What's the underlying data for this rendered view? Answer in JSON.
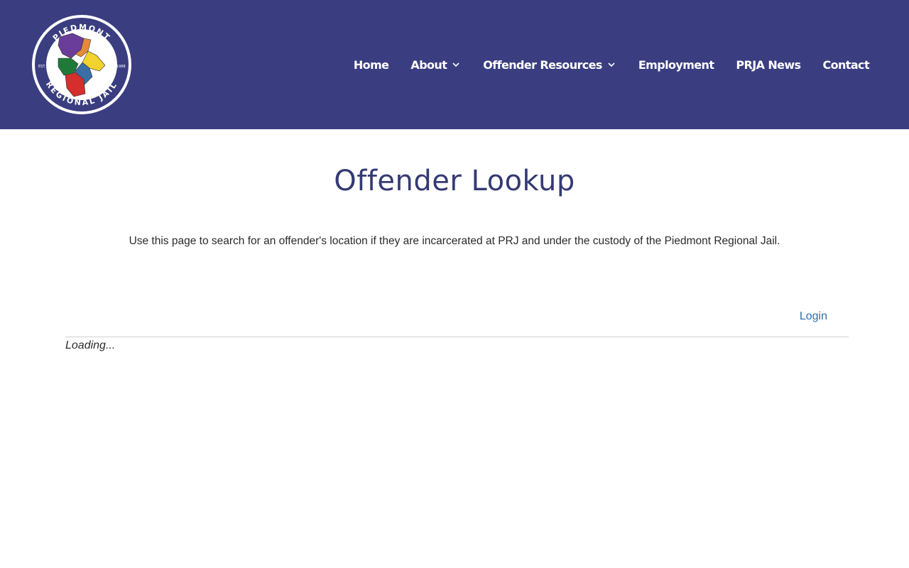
{
  "header": {
    "logo": {
      "top_text": "PIEDMONT",
      "bottom_text": "REGIONAL JAIL",
      "left_text": "EST.",
      "right_text": "1988"
    },
    "nav": [
      {
        "label": "Home",
        "has_dropdown": false
      },
      {
        "label": "About",
        "has_dropdown": true
      },
      {
        "label": "Offender Resources",
        "has_dropdown": true
      },
      {
        "label": "Employment",
        "has_dropdown": false
      },
      {
        "label": "PRJA News",
        "has_dropdown": false
      },
      {
        "label": "Contact",
        "has_dropdown": false
      }
    ]
  },
  "main": {
    "title": "Offender Lookup",
    "intro": "Use this page to search for an offender's location if they are incarcerated at PRJ and under the custody of the Piedmont Regional Jail.",
    "login_label": "Login",
    "loading_text": "Loading..."
  },
  "colors": {
    "header_bg": "#3a3e80",
    "title": "#343a74",
    "link": "#2f6fad"
  }
}
